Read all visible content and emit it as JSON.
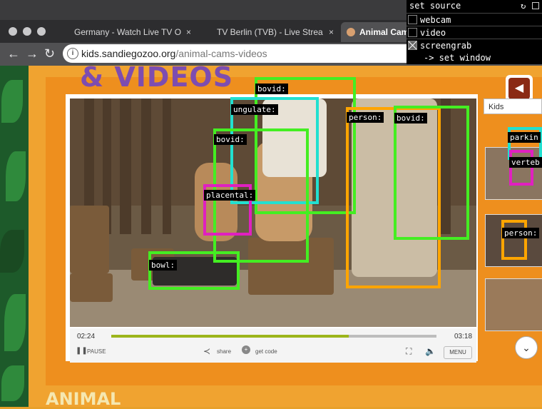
{
  "browser": {
    "tabs": [
      {
        "label": "Germany - Watch Live TV O",
        "active": false
      },
      {
        "label": "TV Berlin (TVB) - Live Strea",
        "active": false
      },
      {
        "label": "Animal Cam",
        "active": true
      }
    ],
    "url_domain": "kids.sandiegozoo.org",
    "url_path": "/animal-cams-videos",
    "info_glyph": "i"
  },
  "page": {
    "title_art": "& VIDEOS",
    "bottom_art": "ANIMAL",
    "side_select": "Kids"
  },
  "player": {
    "current_time": "02:24",
    "duration": "03:18",
    "progress": 0.73,
    "pause_label": "PAUSE",
    "share_label": "share",
    "get_code_label": "get code",
    "menu_label": "MENU"
  },
  "detections": [
    {
      "label": "bovid:",
      "color": "#44ee22"
    },
    {
      "label": "ungulate:",
      "color": "#22e0d0"
    },
    {
      "label": "bovid:",
      "color": "#44ee22"
    },
    {
      "label": "placental:",
      "color": "#e020c0"
    },
    {
      "label": "person:",
      "color": "#ffa500"
    },
    {
      "label": "bovid:",
      "color": "#44ee22"
    },
    {
      "label": "bowl:",
      "color": "#44ee22"
    },
    {
      "label": "parkin",
      "color": "#22e0d0"
    },
    {
      "label": "verteb",
      "color": "#e020c0"
    },
    {
      "label": "person:",
      "color": "#ffa500"
    }
  ],
  "overlay": {
    "header": "set source",
    "header_icons": [
      "refresh-icon",
      "window-icon"
    ],
    "options": [
      {
        "label": "webcam",
        "checked": false
      },
      {
        "label": "video",
        "checked": false
      },
      {
        "label": "screengrab",
        "checked": true
      }
    ],
    "set_window": "-> set window"
  }
}
